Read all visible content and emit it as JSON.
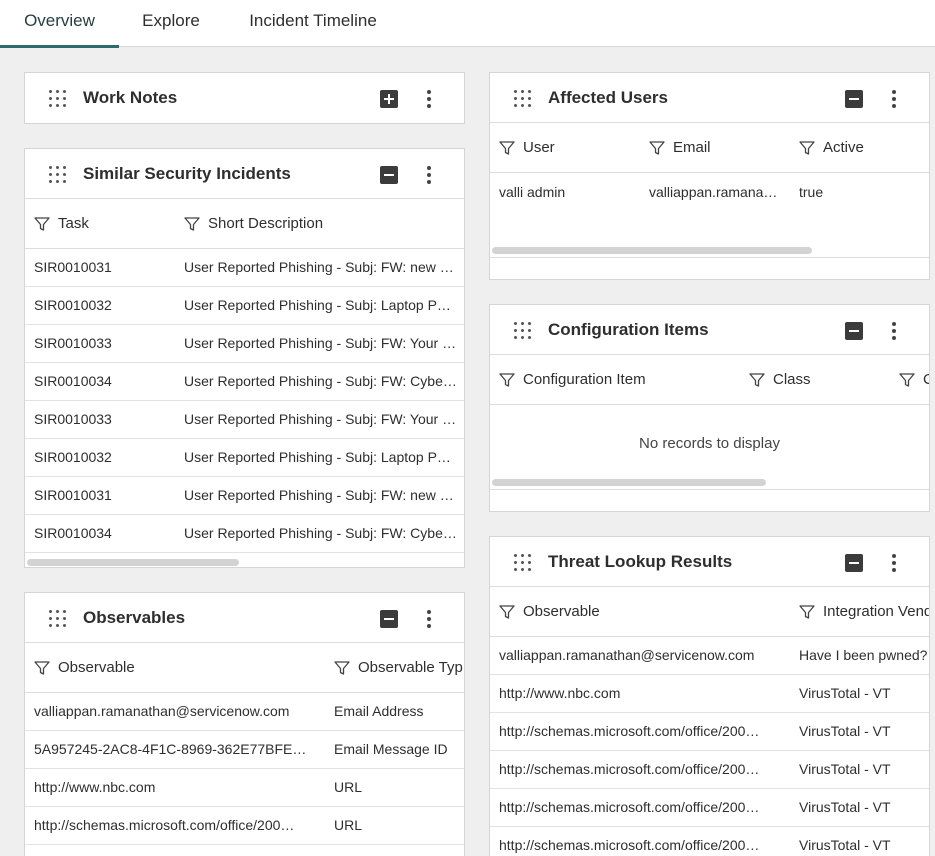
{
  "tabs": [
    {
      "label": "Overview"
    },
    {
      "label": "Explore"
    },
    {
      "label": "Incident Timeline"
    }
  ],
  "icons": {
    "grip": "drag-grip-icon",
    "filter": "filter-funnel-icon",
    "kebab": "more-vertical-icon",
    "plus": "plus-square-icon",
    "minus": "minus-square-icon"
  },
  "colors": {
    "active_tab_underline": "#2e6a6c",
    "background": "#efefef"
  },
  "work_notes": {
    "title": "Work Notes"
  },
  "similar_incidents": {
    "title": "Similar Security Incidents",
    "columns": [
      "Task",
      "Short Description"
    ],
    "rows": [
      [
        "SIR0010031",
        "User Reported Phishing - Subj: FW: new …"
      ],
      [
        "SIR0010032",
        "User Reported Phishing - Subj: Laptop P…"
      ],
      [
        "SIR0010033",
        "User Reported Phishing - Subj: FW: Your …"
      ],
      [
        "SIR0010034",
        "User Reported Phishing - Subj: FW: Cybe…"
      ],
      [
        "SIR0010033",
        "User Reported Phishing - Subj: FW: Your …"
      ],
      [
        "SIR0010032",
        "User Reported Phishing - Subj: Laptop P…"
      ],
      [
        "SIR0010031",
        "User Reported Phishing - Subj: FW: new …"
      ],
      [
        "SIR0010034",
        "User Reported Phishing - Subj: FW: Cybe…"
      ]
    ]
  },
  "observables": {
    "title": "Observables",
    "columns": [
      "Observable",
      "Observable Typ"
    ],
    "rows": [
      [
        "valliappan.ramanathan@servicenow.com",
        "Email Address"
      ],
      [
        "5A957245-2AC8-4F1C-8969-362E77BFE…",
        "Email Message ID"
      ],
      [
        "http://www.nbc.com",
        "URL"
      ],
      [
        "http://schemas.microsoft.com/office/200…",
        "URL"
      ]
    ]
  },
  "affected_users": {
    "title": "Affected Users",
    "columns": [
      "User",
      "Email",
      "Active"
    ],
    "rows": [
      [
        "valli admin",
        "valliappan.ramana…",
        "true"
      ]
    ]
  },
  "config_items": {
    "title": "Configuration Items",
    "columns": [
      "Configuration Item",
      "Class",
      "C"
    ],
    "empty": "No records to display"
  },
  "threat_lookup": {
    "title": "Threat Lookup Results",
    "columns": [
      "Observable",
      "Integration Vend"
    ],
    "rows": [
      [
        "valliappan.ramanathan@servicenow.com",
        "Have I been pwned?"
      ],
      [
        "http://www.nbc.com",
        "VirusTotal - VT"
      ],
      [
        "http://schemas.microsoft.com/office/200…",
        "VirusTotal - VT"
      ],
      [
        "http://schemas.microsoft.com/office/200…",
        "VirusTotal - VT"
      ],
      [
        "http://schemas.microsoft.com/office/200…",
        "VirusTotal - VT"
      ],
      [
        "http://schemas.microsoft.com/office/200…",
        "VirusTotal - VT"
      ]
    ]
  }
}
